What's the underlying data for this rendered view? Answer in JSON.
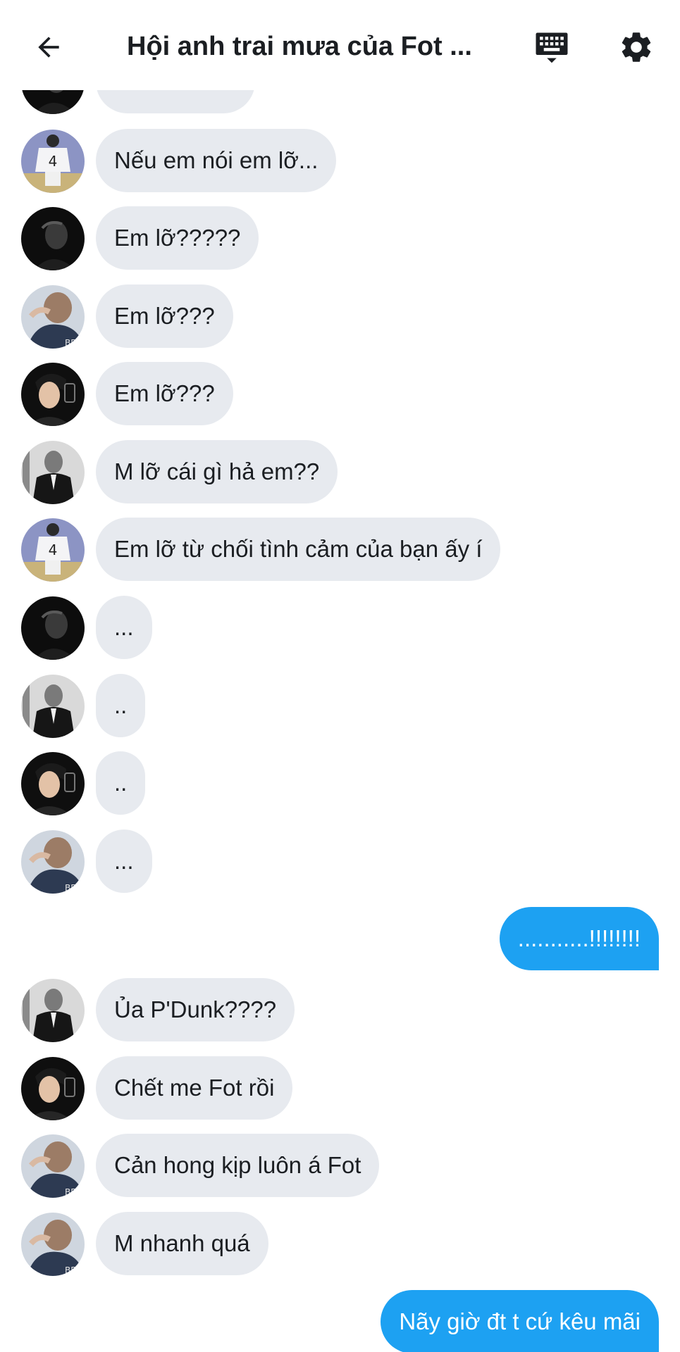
{
  "header": {
    "title": "Hội anh trai mưa của Fot ...",
    "back_icon": "back-arrow-icon",
    "keyboard_icon": "keyboard-icon",
    "settings_icon": "gear-icon"
  },
  "colors": {
    "own_bubble": "#1da1f2",
    "other_bubble": "#e7eaef",
    "text": "#1b1e22"
  },
  "messages": [
    {
      "text": "",
      "own": false,
      "avatar": "dark"
    },
    {
      "text": "Nếu em nói em lỡ...",
      "own": false,
      "avatar": "jersey"
    },
    {
      "text": "Em lỡ?????",
      "own": false,
      "avatar": "dark"
    },
    {
      "text": "Em lỡ???",
      "own": false,
      "avatar": "hoodie"
    },
    {
      "text": "Em lỡ???",
      "own": false,
      "avatar": "selfie"
    },
    {
      "text": "M lỡ cái gì hả em??",
      "own": false,
      "avatar": "suit"
    },
    {
      "text": "Em lỡ từ chối tình cảm của bạn ấy í",
      "own": false,
      "avatar": "jersey"
    },
    {
      "text": "...",
      "own": false,
      "avatar": "dark"
    },
    {
      "text": "..",
      "own": false,
      "avatar": "suit"
    },
    {
      "text": "..",
      "own": false,
      "avatar": "selfie"
    },
    {
      "text": "...",
      "own": false,
      "avatar": "hoodie"
    },
    {
      "text": "...........!!!!!!!!",
      "own": true
    },
    {
      "text": "Ủa P'Dunk????",
      "own": false,
      "avatar": "suit"
    },
    {
      "text": "Chết me Fot rồi",
      "own": false,
      "avatar": "selfie"
    },
    {
      "text": "Cản hong kịp luôn á Fot",
      "own": false,
      "avatar": "hoodie"
    },
    {
      "text": "M nhanh quá",
      "own": false,
      "avatar": "hoodie"
    },
    {
      "text": "Nãy giờ đt t cứ kêu mãi",
      "own": true
    }
  ]
}
